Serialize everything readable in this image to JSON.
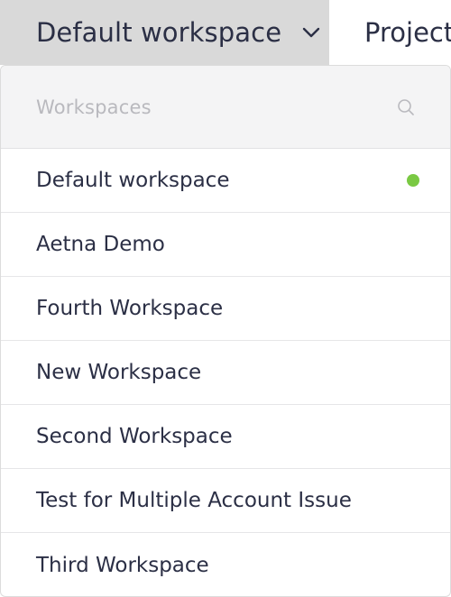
{
  "topbar": {
    "workspace_switcher_label": "Default workspace",
    "next_nav_label": "Project"
  },
  "dropdown": {
    "header_title": "Workspaces",
    "search_icon": "search-icon",
    "active_indicator_color": "#7ac943",
    "items": [
      {
        "label": "Default workspace",
        "active": true
      },
      {
        "label": "Aetna Demo",
        "active": false
      },
      {
        "label": "Fourth Workspace",
        "active": false
      },
      {
        "label": "New Workspace",
        "active": false
      },
      {
        "label": "Second Workspace",
        "active": false
      },
      {
        "label": "Test for Multiple Account Issue",
        "active": false
      },
      {
        "label": "Third Workspace",
        "active": false
      }
    ]
  }
}
